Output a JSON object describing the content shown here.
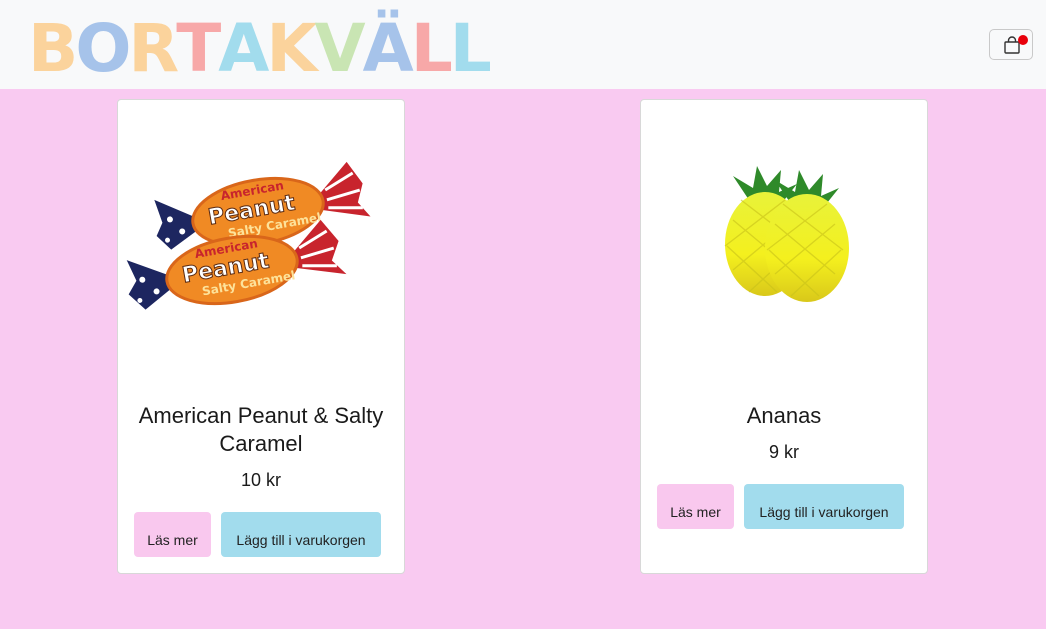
{
  "header": {
    "logo_letters": [
      {
        "char": "B",
        "color": "#fbd39c"
      },
      {
        "char": "O",
        "color": "#a6c3ea"
      },
      {
        "char": "R",
        "color": "#fbd39c"
      },
      {
        "char": "T",
        "color": "#f7a8a8"
      },
      {
        "char": "A",
        "color": "#a2dced"
      },
      {
        "char": "K",
        "color": "#fbd39c"
      },
      {
        "char": "V",
        "color": "#c9e5b3"
      },
      {
        "char": "Ä",
        "color": "#a6c3ea"
      },
      {
        "char": "L",
        "color": "#f7a8a8"
      },
      {
        "char": "L",
        "color": "#a2dced"
      }
    ],
    "cart_icon": "shopping-bag-icon",
    "cart_badge_color": "#e8000b"
  },
  "products": [
    {
      "name": "American Peanut & Salty Caramel",
      "price": "10 kr",
      "image": "peanut-caramel-candy",
      "more_label": "Läs mer",
      "add_label": "Lägg till i varukorgen"
    },
    {
      "name": "Ananas",
      "price": "9 kr",
      "image": "pineapple-candy",
      "more_label": "Läs mer",
      "add_label": "Lägg till i varukorgen"
    }
  ],
  "colors": {
    "page_background": "#f9caf1",
    "navbar_background": "#f8f9fa",
    "more_button": "#f9c8ee",
    "add_button": "#a2dced"
  }
}
